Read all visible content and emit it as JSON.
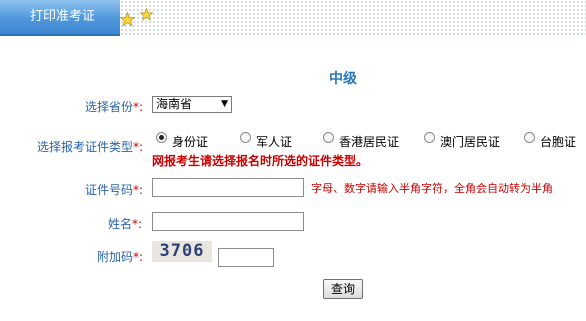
{
  "header": {
    "tab_label": "打印准考证"
  },
  "form": {
    "level_title": "中级",
    "province": {
      "label": "选择省份",
      "required_mark": "*:",
      "selected": "海南省"
    },
    "id_type": {
      "label": "选择报考证件类型",
      "required_mark": "*:",
      "options": [
        "身份证",
        "军人证",
        "香港居民证",
        "澳门居民证",
        "台胞证"
      ],
      "selected_index": 0,
      "warning": "网报考生请选择报名时所选的证件类型。"
    },
    "id_number": {
      "label": "证件号码",
      "required_mark": "*:",
      "value": "",
      "hint": "字母、数字请输入半角字符，全角会自动转为半角"
    },
    "name": {
      "label": "姓名",
      "required_mark": "*:",
      "value": ""
    },
    "captcha": {
      "label": "附加码",
      "required_mark": "*:",
      "image_text": "3706",
      "value": ""
    },
    "submit_label": "查询"
  },
  "colors": {
    "tab": "#4f97dc",
    "label": "#2a63a8",
    "title": "#2a78b8",
    "warning": "#cc0000"
  }
}
